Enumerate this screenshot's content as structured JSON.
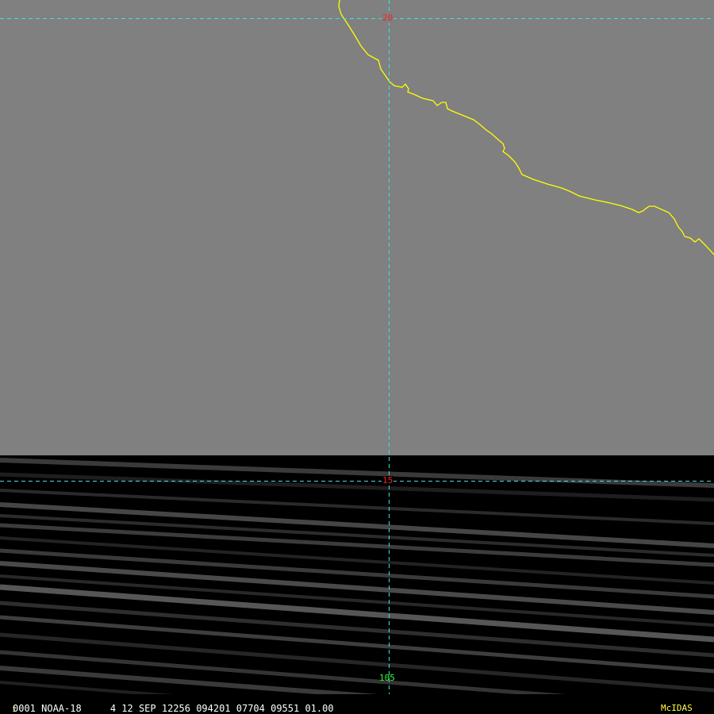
{
  "map": {
    "lat_lines": [
      {
        "label": "20"
      },
      {
        "label": "15"
      }
    ],
    "lon_lines": [
      {
        "label": "105"
      }
    ],
    "colors": {
      "land": "#808080",
      "no_data": "#000000",
      "coastline": "#ffff00",
      "grid": "#40e0e0",
      "lat_label": "#ff2020",
      "lon_label": "#30ff30",
      "brand": "#ffff40"
    }
  },
  "status": {
    "frame_number": "1",
    "info": "0001 NOAA-18     4 12 SEP 12256 094201 07704 09551 01.00",
    "brand": "McIDAS"
  }
}
